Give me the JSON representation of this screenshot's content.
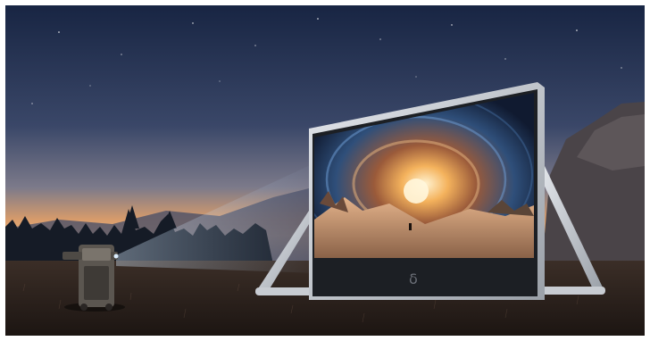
{
  "scene": {
    "subject": "outdoor-projector-and-inflatable-screen",
    "colors": {
      "sky_top": "#1c2a4a",
      "sky_mid": "#3d4a6e",
      "horizon": "#d99a6a",
      "horizon_glow": "#f2c08a",
      "ground": "#2a1f1a",
      "screen_frame": "#cfd3da",
      "screen_bezel": "#1a1d22",
      "beam": "#bcd6f0"
    },
    "logo_glyph": "δ"
  }
}
